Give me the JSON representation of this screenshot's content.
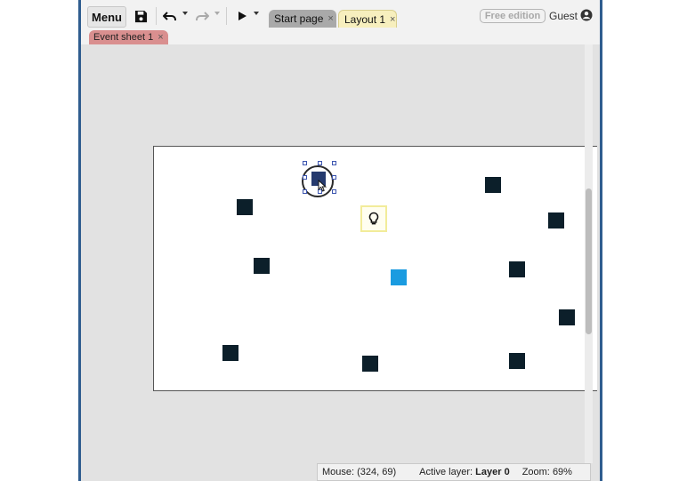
{
  "toolbar": {
    "menu_label": "Menu",
    "icons": [
      "save-icon",
      "undo-icon",
      "redo-icon",
      "play-icon"
    ],
    "tabs": [
      {
        "label": "Start page",
        "close": "×",
        "active": false
      },
      {
        "label": "Layout 1",
        "close": "×",
        "active": true
      }
    ],
    "edition_badge": "Free edition",
    "user_label": "Guest"
  },
  "subtabs": [
    {
      "label": "Event sheet 1",
      "close": "×"
    }
  ],
  "status": {
    "mouse_label": "Mouse:",
    "mouse_value": "(324, 69)",
    "layer_label": "Active layer:",
    "layer_value": "Layer 0",
    "zoom_label": "Zoom:",
    "zoom_value": "69%"
  },
  "colors": {
    "sprite": "#0c1f2a",
    "player_sprite": "#1a9be0",
    "selected_sprite": "#253a6e",
    "layout_tab": "#f7efbe",
    "event_tab": "#d98f8f"
  }
}
